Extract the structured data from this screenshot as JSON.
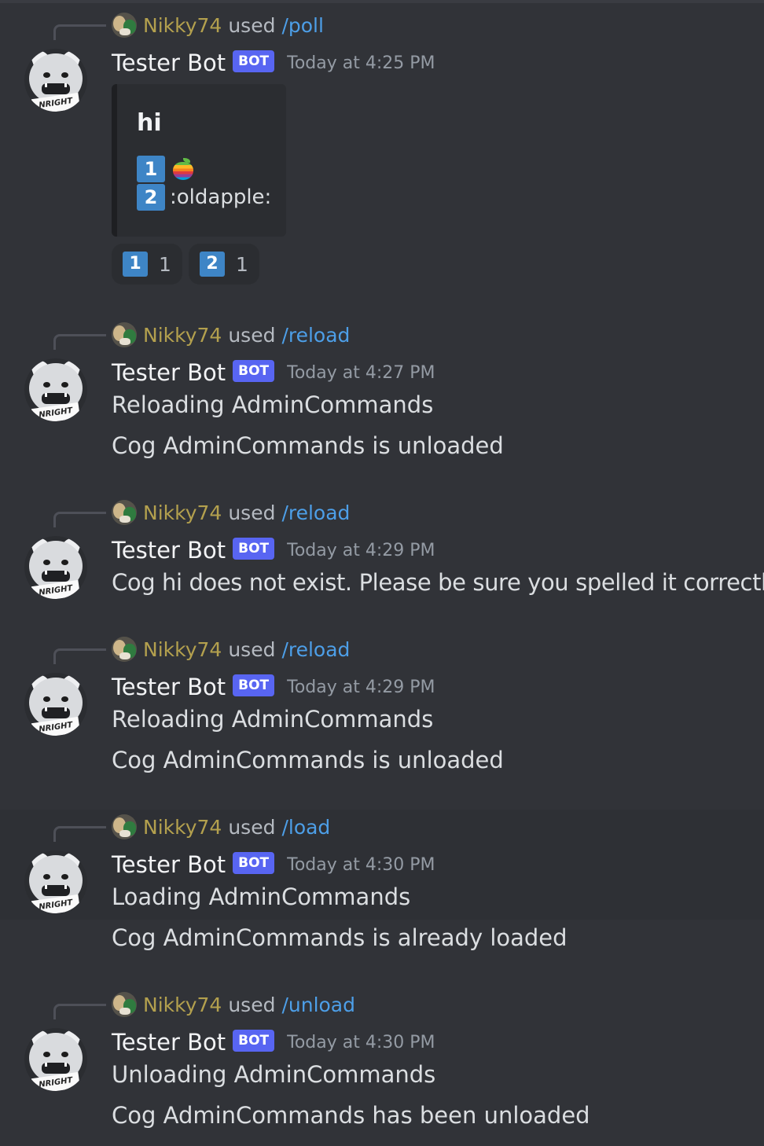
{
  "messages": [
    {
      "invoker": "Nikky74",
      "used": "used",
      "command": "/poll",
      "bot": "Tester Bot",
      "badge": "BOT",
      "time": "Today at 4:25 PM",
      "poll": {
        "title": "hi",
        "options": [
          {
            "key": "1",
            "emoji": "apple-rainbow-icon"
          },
          {
            "key": "2",
            "text": ":oldapple:"
          }
        ],
        "reactions": [
          {
            "key": "1",
            "count": "1"
          },
          {
            "key": "2",
            "count": "1"
          }
        ]
      }
    },
    {
      "invoker": "Nikky74",
      "used": "used",
      "command": "/reload",
      "bot": "Tester Bot",
      "badge": "BOT",
      "time": "Today at 4:27 PM",
      "lines": [
        "Reloading AdminCommands",
        "Cog AdminCommands is unloaded"
      ]
    },
    {
      "invoker": "Nikky74",
      "used": "used",
      "command": "/reload",
      "bot": "Tester Bot",
      "badge": "BOT",
      "time": "Today at 4:29 PM",
      "lines": [
        "Cog hi does not exist. Please be sure you spelled it correctly."
      ]
    },
    {
      "invoker": "Nikky74",
      "used": "used",
      "command": "/reload",
      "bot": "Tester Bot",
      "badge": "BOT",
      "time": "Today at 4:29 PM",
      "lines": [
        "Reloading AdminCommands",
        "Cog AdminCommands is unloaded"
      ]
    },
    {
      "invoker": "Nikky74",
      "used": "used",
      "command": "/load",
      "bot": "Tester Bot",
      "badge": "BOT",
      "time": "Today at 4:30 PM",
      "lines": [
        "Loading AdminCommands",
        "Cog AdminCommands is already loaded"
      ]
    },
    {
      "invoker": "Nikky74",
      "used": "used",
      "command": "/unload",
      "bot": "Tester Bot",
      "badge": "BOT",
      "time": "Today at 4:30 PM",
      "lines": [
        "Unloading AdminCommands",
        "Cog AdminCommands has been unloaded"
      ]
    }
  ],
  "avatar_text": "NRIGHT",
  "colors": {
    "background": "#313338",
    "username": "#b3a04e",
    "command": "#4d9fe8",
    "badge": "#5865f2",
    "keycap": "#3e85c6"
  }
}
